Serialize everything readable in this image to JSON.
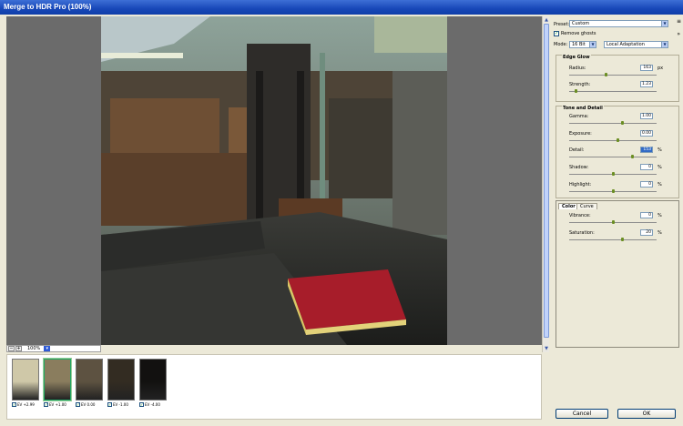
{
  "window": {
    "title": "Merge to HDR Pro (100%)"
  },
  "viewer": {
    "zoom": "100%"
  },
  "filmstrip": [
    {
      "label": "EV +2.99",
      "checked": true,
      "selected": false,
      "tone": "#cfc8a8"
    },
    {
      "label": "EV +1.00",
      "checked": true,
      "selected": true,
      "tone": "#8a7d5e"
    },
    {
      "label": "EV 0.00",
      "checked": true,
      "selected": false,
      "tone": "#5d5241"
    },
    {
      "label": "EV -1.00",
      "checked": true,
      "selected": false,
      "tone": "#332c22"
    },
    {
      "label": "EV -4.00",
      "checked": true,
      "selected": false,
      "tone": "#121110"
    }
  ],
  "panel": {
    "preset_label": "Preset:",
    "preset_value": "Custom",
    "remove_ghosts": "Remove ghosts",
    "mode_label": "Mode:",
    "bit_depth": "16 Bit",
    "method": "Local Adaptation",
    "edge_glow": {
      "title": "Edge Glow",
      "radius": {
        "label": "Radius:",
        "value": "163",
        "unit": "px",
        "pos": 0.42
      },
      "strength": {
        "label": "Strength:",
        "value": "1.23",
        "unit": "",
        "pos": 0.07
      }
    },
    "tone_detail": {
      "title": "Tone and Detail",
      "gamma": {
        "label": "Gamma:",
        "value": "1.00",
        "unit": "",
        "pos": 0.6
      },
      "exposure": {
        "label": "Exposure:",
        "value": "0.00",
        "unit": "",
        "pos": 0.55
      },
      "detail": {
        "label": "Detail:",
        "value": "153",
        "unit": "%",
        "pos": 0.72
      },
      "shadow": {
        "label": "Shadow:",
        "value": "0",
        "unit": "%",
        "pos": 0.5
      },
      "highlight": {
        "label": "Highlight:",
        "value": "0",
        "unit": "%",
        "pos": 0.5
      }
    },
    "tabs": {
      "color": "Color",
      "curve": "Curve"
    },
    "color": {
      "vibrance": {
        "label": "Vibrance:",
        "value": "0",
        "unit": "%",
        "pos": 0.5
      },
      "saturation": {
        "label": "Saturation:",
        "value": "20",
        "unit": "%",
        "pos": 0.6
      }
    },
    "cancel": "Cancel",
    "ok": "OK"
  }
}
